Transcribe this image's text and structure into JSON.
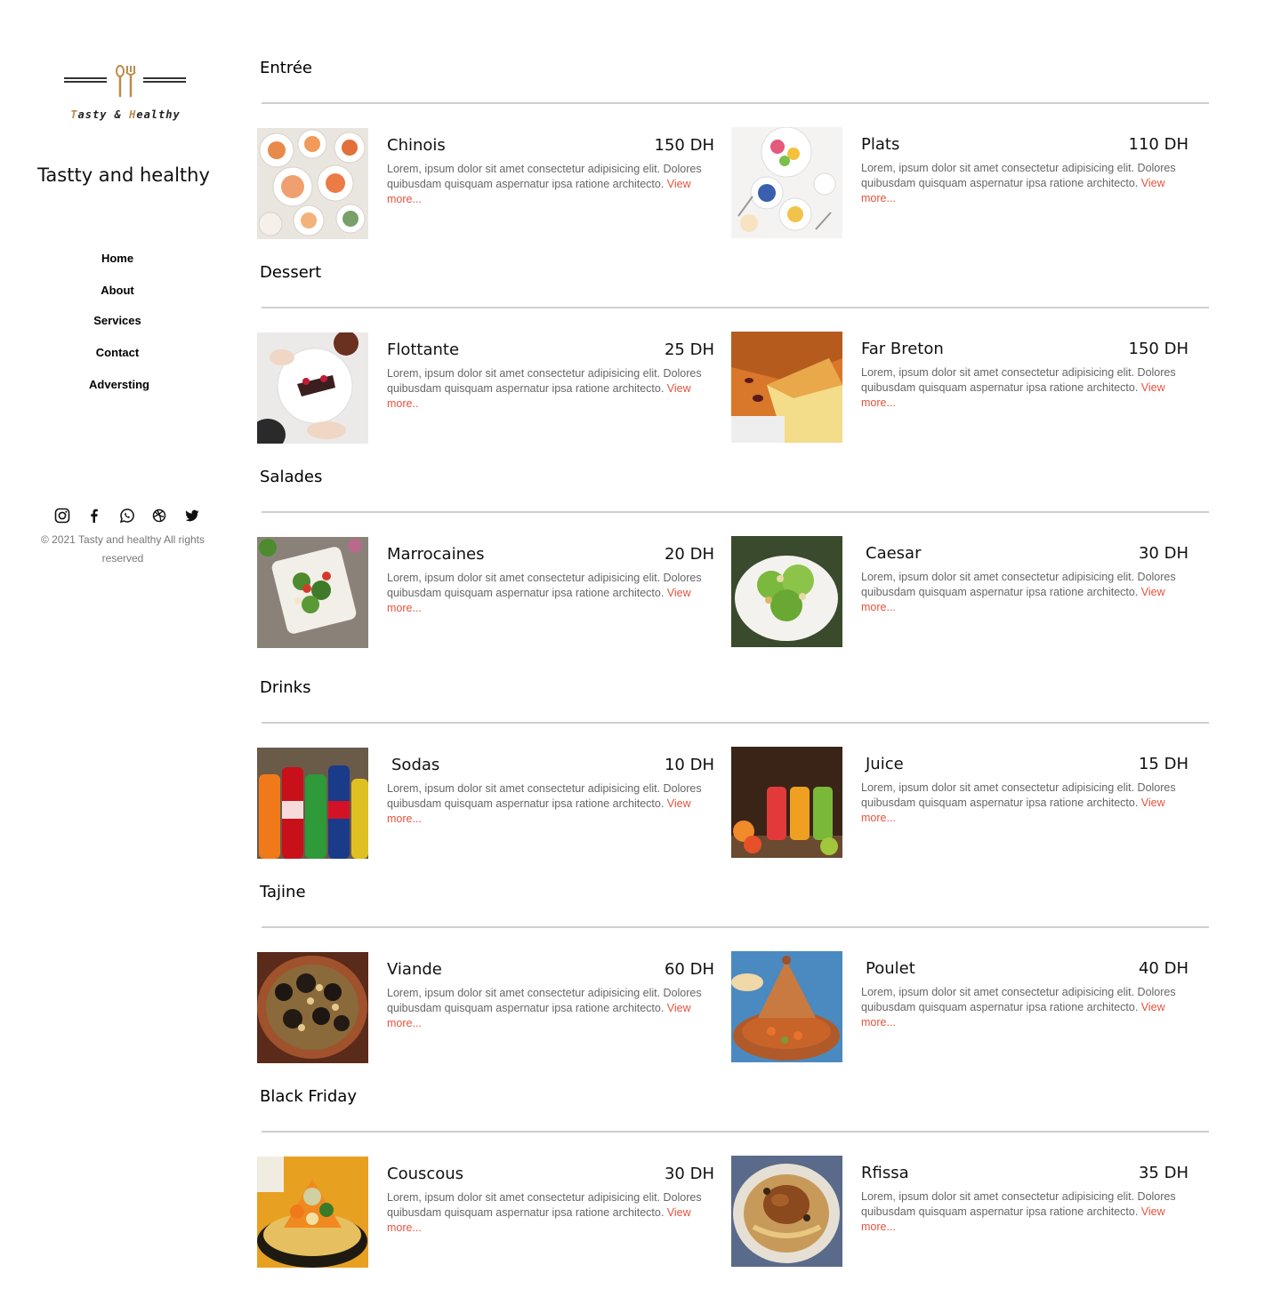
{
  "brand": {
    "logo_word1_initial": "T",
    "logo_word1_rest": "asty",
    "logo_amp": " & ",
    "logo_word2_initial": "H",
    "logo_word2_rest": "ealthy",
    "site_title": "Tastty and healthy",
    "logo_icon": "fork-spoon-icon"
  },
  "nav": {
    "items": [
      "Home",
      "About",
      "Services",
      "Contact",
      "Adversting"
    ]
  },
  "social": {
    "icons": [
      "instagram-icon",
      "facebook-icon",
      "whatsapp-icon",
      "dribbble-icon",
      "twitter-icon"
    ]
  },
  "footer": {
    "copyright": "© 2021 Tasty and healthy All rights reserved"
  },
  "colors": {
    "accent": "#e5533d",
    "logo_gold": "#c08a4a",
    "divider": "#cfcfcf",
    "muted_text": "#666666"
  },
  "sections": [
    {
      "title": "Entrée",
      "items": [
        {
          "name": "Chinois",
          "price": "150 DH",
          "desc": "Lorem, ipsum dolor sit amet consectetur adipisicing elit. Dolores quibusdam quisquam aspernatur ipsa ratione architecto.",
          "link": "View more...",
          "image": "chinese-dishes-photo"
        },
        {
          "name": "Plats",
          "price": "110 DH",
          "desc": "Lorem,  ipsum dolor sit  amet consectetur  adipisicing elit. Dolores quibusdam quisquam aspernatur ipsa  ratione architecto.",
          "link": "View more...",
          "image": "plates-photo"
        }
      ]
    },
    {
      "title": "Dessert",
      "items": [
        {
          "name": "Flottante",
          "price": "25 DH",
          "desc": "Lorem, ipsum dolor sit amet consectetur adipisicing elit. Dolores quibusdam quisquam aspernatur ipsa ratione architecto.",
          "link": "View more..",
          "image": "dessert-plate-photo"
        },
        {
          "name": "Far Breton",
          "price": "150 DH",
          "desc": "Lorem,  ipsum dolor sit  amet consectetur  adipisicing elit. Dolores quibusdam quisquam aspernatur ipsa  ratione architecto.",
          "link": "View more...",
          "image": "far-breton-photo"
        }
      ]
    },
    {
      "title": "Salades",
      "items": [
        {
          "name": "Marrocaines",
          "price": "20 DH",
          "desc": "Lorem, ipsum dolor sit amet consectetur adipisicing elit. Dolores quibusdam quisquam aspernatur ipsa ratione architecto.",
          "link": "View more...",
          "image": "moroccan-salad-photo"
        },
        {
          "name": "Caesar",
          "price": "30 DH",
          "desc": "Lorem,  ipsum dolor sit  amet consectetur  adipisicing elit. Dolores quibusdam quisquam aspernatur ipsa  ratione architecto.",
          "link": "View more...",
          "image": "caesar-salad-photo"
        }
      ]
    },
    {
      "title": "Drinks",
      "items": [
        {
          "name": "Sodas",
          "price": "10 DH",
          "desc": "Lorem, ipsum dolor sit amet consectetur adipisicing elit. Dolores quibusdam quisquam aspernatur ipsa ratione architecto.",
          "link": "View more...",
          "image": "soda-bottles-photo"
        },
        {
          "name": "Juice",
          "price": "15 DH",
          "desc": "Lorem,  ipsum dolor sit  amet consectetur  adipisicing elit. Dolores quibusdam quisquam aspernatur ipsa  ratione architecto.",
          "link": "View more...",
          "image": "juice-bottles-photo"
        }
      ]
    },
    {
      "title": "Tajine",
      "items": [
        {
          "name": "Viande",
          "price": "60 DH",
          "desc": "Lorem, ipsum dolor sit amet consectetur adipisicing elit. Dolores quibusdam quisquam aspernatur ipsa ratione architecto.",
          "link": "View more...",
          "image": "meat-tajine-photo"
        },
        {
          "name": "Poulet",
          "price": "40 DH",
          "desc": "Lorem,  ipsum dolor sit  amet consectetur  adipisicing elit. Dolores quibusdam quisquam aspernatur ipsa  ratione architecto.",
          "link": "View more...",
          "image": "chicken-tajine-photo"
        }
      ]
    },
    {
      "title": "Black Friday",
      "items": [
        {
          "name": "Couscous",
          "price": "30 DH",
          "desc": "Lorem, ipsum dolor sit amet consectetur adipisicing elit. Dolores quibusdam quisquam aspernatur ipsa ratione architecto.",
          "link": "View more...",
          "image": "couscous-photo"
        },
        {
          "name": "Rfissa",
          "price": "35 DH",
          "desc": "Lorem,  ipsum dolor sit  amet consectetur  adipisicing elit. Dolores quibusdam quisquam aspernatur ipsa  ratione architecto.",
          "link": "View more...",
          "image": "rfissa-photo"
        }
      ]
    }
  ]
}
